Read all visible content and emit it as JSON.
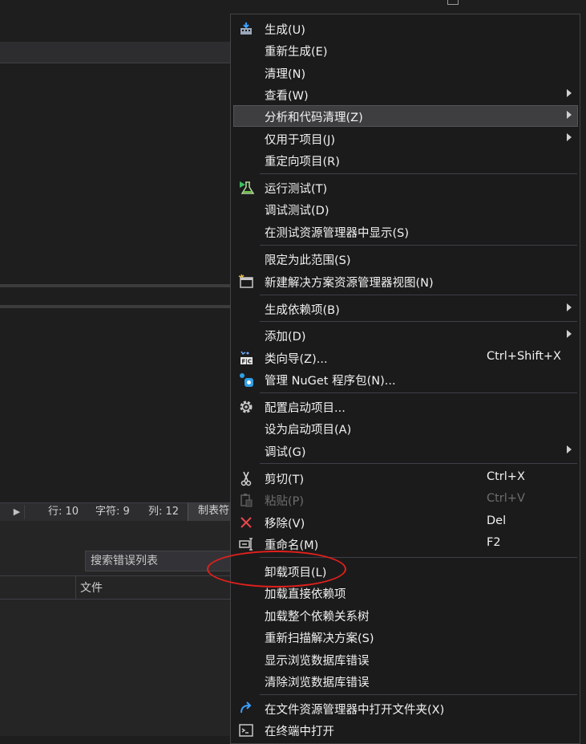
{
  "status_bar": {
    "line": "行: 10",
    "char": "字符: 9",
    "col": "列: 12",
    "tab": "制表符"
  },
  "error_list": {
    "search_placeholder": "搜索错误列表",
    "col_file": "文件"
  },
  "menu": {
    "build": "生成(U)",
    "rebuild": "重新生成(E)",
    "clean": "清理(N)",
    "view": "查看(W)",
    "analyze": "分析和代码清理(Z)",
    "project_only": "仅用于项目(J)",
    "retarget": "重定向项目(R)",
    "run_tests": "运行测试(T)",
    "debug_tests": "调试测试(D)",
    "show_in_test_explorer": "在测试资源管理器中显示(S)",
    "scope_to_this": "限定为此范围(S)",
    "new_solution_view": "新建解决方案资源管理器视图(N)",
    "build_dependencies": "生成依赖项(B)",
    "add": "添加(D)",
    "class_wizard": "类向导(Z)...",
    "class_wizard_shortcut": "Ctrl+Shift+X",
    "manage_nuget": "管理 NuGet 程序包(N)...",
    "configure_startup": "配置启动项目...",
    "set_startup": "设为启动项目(A)",
    "debug": "调试(G)",
    "cut": "剪切(T)",
    "cut_shortcut": "Ctrl+X",
    "paste": "粘贴(P)",
    "paste_shortcut": "Ctrl+V",
    "remove": "移除(V)",
    "remove_shortcut": "Del",
    "rename": "重命名(M)",
    "rename_shortcut": "F2",
    "unload_project": "卸载项目(L)",
    "load_direct_deps": "加载直接依赖项",
    "load_dep_tree": "加载整个依赖关系树",
    "rescan_solution": "重新扫描解决方案(S)",
    "show_browse_db_errors": "显示浏览数据库错误",
    "clear_browse_db_errors": "清除浏览数据库错误",
    "open_folder_in_explorer": "在文件资源管理器中打开文件夹(X)",
    "open_in_terminal": "在终端中打开"
  },
  "colors": {
    "menu_bg": "#1b1b1c",
    "highlight": "#3e3e40",
    "annotation": "#e3201b"
  }
}
